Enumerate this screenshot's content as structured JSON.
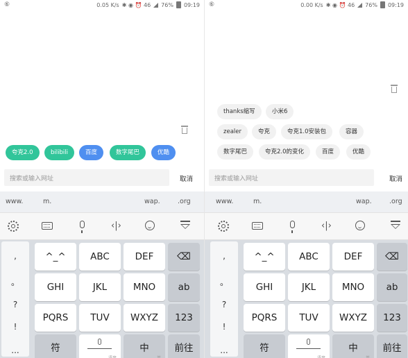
{
  "left": {
    "status": {
      "carrier": "⑥",
      "speed": "0.05 K/s",
      "icons": "✱ ◉ ⏰ 46",
      "battery": "76%",
      "time": "09:19"
    },
    "chips": [
      {
        "label": "夸克2.0",
        "color": "green"
      },
      {
        "label": "bilibili",
        "color": "green"
      },
      {
        "label": "百度",
        "color": "blue"
      },
      {
        "label": "数字尾巴",
        "color": "green"
      },
      {
        "label": "优酷",
        "color": "blue"
      }
    ],
    "search": {
      "placeholder": "搜索或输入网址",
      "cancel": "取消"
    },
    "urlbar": [
      "www.",
      "m.",
      "wap.",
      ".org"
    ],
    "keyboard": {
      "symbols": [
        ",",
        "。",
        "?",
        "!",
        "..."
      ],
      "rows": [
        [
          "^_^",
          "ABC",
          "DEF"
        ],
        [
          "GHI",
          "JKL",
          "MNO"
        ],
        [
          "PQRS",
          "TUV",
          "WXYZ"
        ]
      ],
      "backspace_icon": "backspace-icon",
      "ab": "ab",
      "num": "123",
      "fu": "符",
      "zhong": "中",
      "zhong_hint": "英",
      "go": "前往",
      "space_hint": "语音"
    }
  },
  "right": {
    "status": {
      "carrier": "⑥",
      "speed": "0.00 K/s",
      "icons": "✱ ◉ ⏰ 46",
      "battery": "76%",
      "time": "09:19"
    },
    "chips": [
      "thanks缩写",
      "小米6",
      "zealer",
      "夸克",
      "夸克1.0安装包",
      "容器",
      "数字尾巴",
      "夸克2.0的变化",
      "百度",
      "优酷"
    ],
    "search": {
      "placeholder": "搜索或输入网址",
      "cancel": "取消"
    },
    "urlbar": [
      "www.",
      "m.",
      "wap.",
      ".org"
    ],
    "keyboard": {
      "symbols": [
        ",",
        "。",
        "?",
        "!",
        "..."
      ],
      "rows": [
        [
          "^_^",
          "ABC",
          "DEF"
        ],
        [
          "GHI",
          "JKL",
          "MNO"
        ],
        [
          "PQRS",
          "TUV",
          "WXYZ"
        ]
      ],
      "ab": "ab",
      "num": "123",
      "fu": "符",
      "zhong": "中",
      "zhong_hint": "英",
      "go": "前往",
      "space_hint": "语音"
    }
  },
  "colors": {
    "green": "#31c59a",
    "blue": "#4f8ff0",
    "chip_gray": "#f1f1f1",
    "keyboard_bg": "#d9dde2"
  }
}
